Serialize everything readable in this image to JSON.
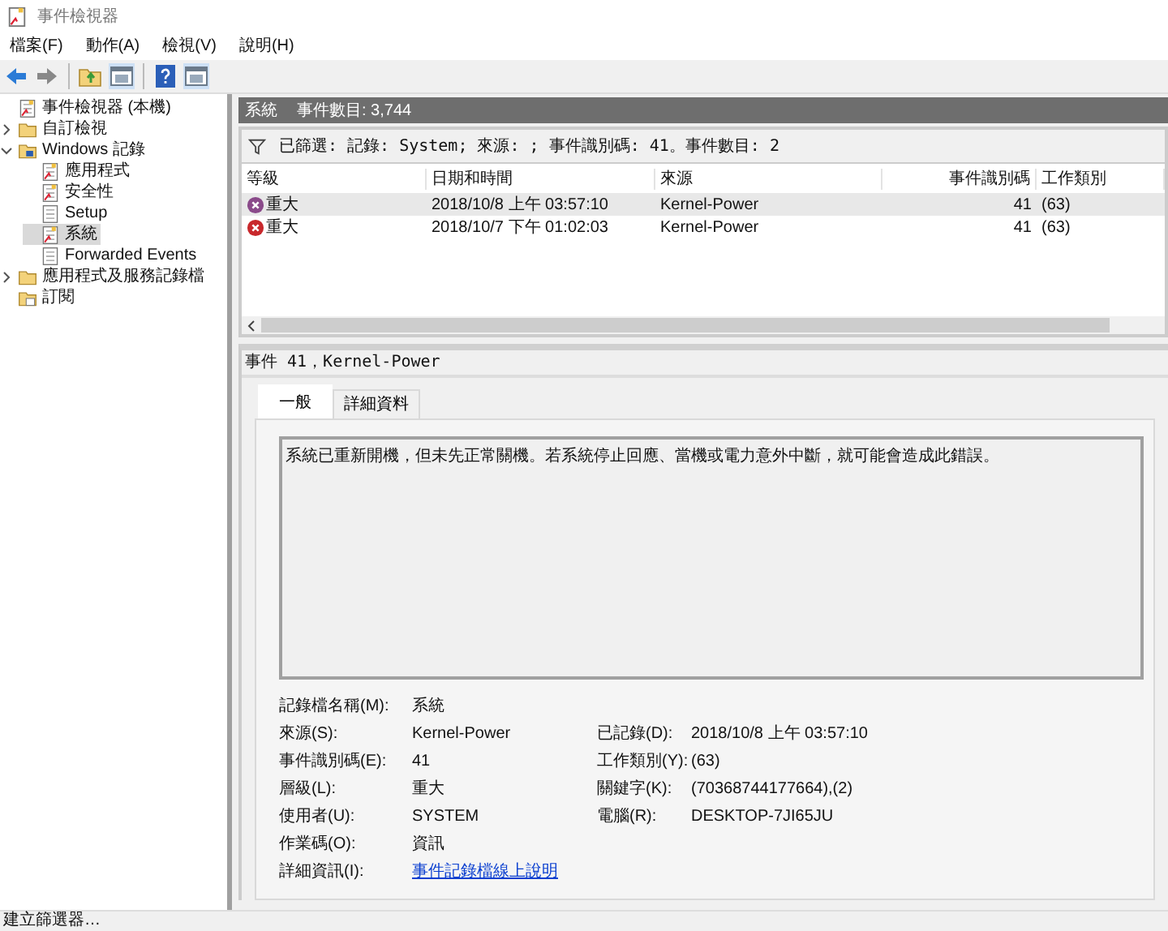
{
  "window": {
    "title": "事件檢視器"
  },
  "menu": [
    "檔案(F)",
    "動作(A)",
    "檢視(V)",
    "說明(H)"
  ],
  "toolbar": [
    {
      "kind": "back"
    },
    {
      "kind": "forward"
    },
    {
      "kind": "sep"
    },
    {
      "kind": "up"
    },
    {
      "kind": "pane"
    },
    {
      "kind": "sep"
    },
    {
      "kind": "help"
    },
    {
      "kind": "pane"
    }
  ],
  "tree": [
    {
      "label": "事件檢視器 (本機)",
      "kind": "viewer",
      "selected": false,
      "children": [
        {
          "label": "自訂檢視",
          "kind": "folder",
          "expanded": false,
          "selected": false
        },
        {
          "label": "Windows 記錄",
          "kind": "winfolder",
          "expanded": true,
          "selected": false,
          "children": [
            {
              "label": "應用程式",
              "kind": "log",
              "selected": false
            },
            {
              "label": "安全性",
              "kind": "log",
              "selected": false
            },
            {
              "label": "Setup",
              "kind": "plainlog",
              "selected": false
            },
            {
              "label": "系統",
              "kind": "log",
              "selected": true
            },
            {
              "label": "Forwarded Events",
              "kind": "plainlog",
              "selected": false
            }
          ]
        },
        {
          "label": "應用程式及服務記錄檔",
          "kind": "folder",
          "expanded": false,
          "selected": false
        },
        {
          "label": "訂閱",
          "kind": "sub",
          "selected": false
        }
      ]
    }
  ],
  "pane_header": {
    "log": "系統",
    "count": "事件數目: 3,744"
  },
  "filter": "已篩選: 記錄: System; 來源: ; 事件識別碼: 41。事件數目: 2",
  "table": {
    "columns": [
      "等級",
      "日期和時間",
      "來源",
      "事件識別碼",
      "工作類別"
    ],
    "rows": [
      {
        "level": "重大",
        "date": "2018/10/8 上午 03:57:10",
        "source": "Kernel-Power",
        "id": "41",
        "task": "(63)",
        "selected": true
      },
      {
        "level": "重大",
        "date": "2018/10/7 下午 01:02:03",
        "source": "Kernel-Power",
        "id": "41",
        "task": "(63)",
        "selected": false
      }
    ]
  },
  "detail": {
    "title": "事件 41，Kernel-Power",
    "tabs": [
      {
        "label": "一般",
        "selected": true
      },
      {
        "label": "詳細資料",
        "selected": false
      }
    ],
    "message": "系統已重新開機，但未先正常關機。若系統停止回應、當機或電力意外中斷，就可能會造成此錯誤。",
    "fields": [
      {
        "label": "記錄檔名稱(M):",
        "value": "系統"
      },
      {
        "label": "來源(S):",
        "value": "Kernel-Power",
        "label2": "已記錄(D):",
        "value2": "2018/10/8 上午 03:57:10"
      },
      {
        "label": "事件識別碼(E):",
        "value": "41",
        "label2": "工作類別(Y):",
        "value2": "(63)"
      },
      {
        "label": "層級(L):",
        "value": "重大",
        "label2": "關鍵字(K):",
        "value2": "(70368744177664),(2)"
      },
      {
        "label": "使用者(U):",
        "value": "SYSTEM",
        "label2": "電腦(R):",
        "value2": "DESKTOP-7JI65JU"
      },
      {
        "label": "作業碼(O):",
        "value": "資訊"
      },
      {
        "label": "詳細資訊(I):",
        "value": "事件記錄檔線上說明",
        "kind": "link"
      }
    ]
  },
  "status_bar": "建立篩選器…"
}
